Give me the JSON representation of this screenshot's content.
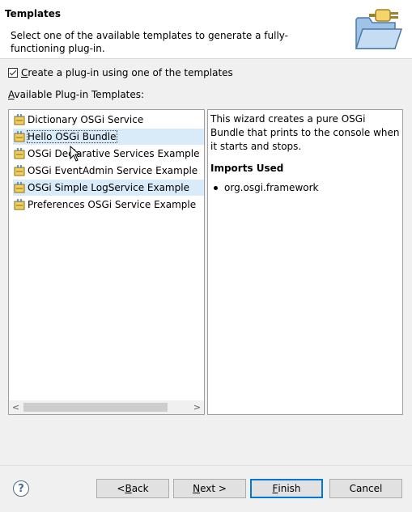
{
  "header": {
    "title": "Templates",
    "description": "Select one of the available templates to generate a fully-functioning plug-in.",
    "art_icon": "folder-with-plug-icon"
  },
  "create_checkbox": {
    "checked": true,
    "mnemonic": "C",
    "label_rest": "reate a plug-in using one of the templates"
  },
  "available_label": {
    "mnemonic": "A",
    "rest": "vailable Plug-in Templates:"
  },
  "templates": [
    {
      "label": "Dictionary OSGi Service",
      "icon": "plugin-template-icon",
      "state": "normal"
    },
    {
      "label": "Hello OSGi Bundle",
      "icon": "plugin-template-icon",
      "state": "selected"
    },
    {
      "label": "OSGi Declarative Services Example",
      "icon": "plugin-template-icon",
      "state": "normal"
    },
    {
      "label": "OSGi EventAdmin Service Example",
      "icon": "plugin-template-icon",
      "state": "normal"
    },
    {
      "label": "OSGi Simple LogService Example",
      "icon": "plugin-template-icon",
      "state": "hover"
    },
    {
      "label": "Preferences OSGi Service Example",
      "icon": "plugin-template-icon",
      "state": "normal"
    }
  ],
  "scrollbar": {
    "left_arrow": "<",
    "right_arrow": ">"
  },
  "description_panel": {
    "text": "This wizard creates a pure OSGi Bundle that prints to the console when it starts and stops.",
    "imports_heading": "Imports Used",
    "imports": [
      "org.osgi.framework"
    ]
  },
  "buttons": {
    "help": "?",
    "back": {
      "pre": "< ",
      "mnemonic": "B",
      "rest": "ack"
    },
    "next": {
      "pre": "",
      "mnemonic": "N",
      "rest": "ext >"
    },
    "finish": {
      "pre": "",
      "mnemonic": "F",
      "rest": "inish"
    },
    "cancel": {
      "label": "Cancel"
    }
  },
  "colors": {
    "selection_bg": "#d9ebf9",
    "default_button_border": "#0078d7"
  }
}
